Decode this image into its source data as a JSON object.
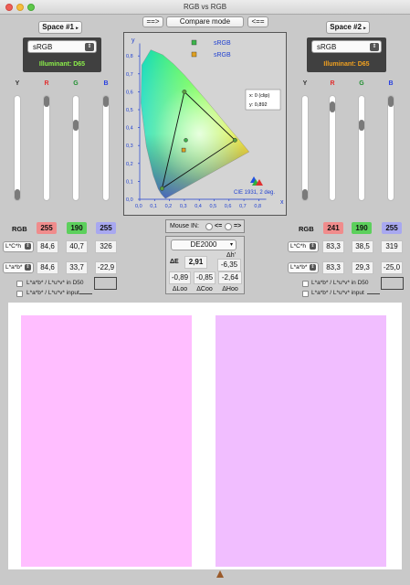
{
  "window": {
    "title": "RGB vs RGB"
  },
  "compare": {
    "left_arrow": "==>",
    "label": "Compare mode",
    "right_arrow": "<=="
  },
  "left": {
    "space_button": "Space #1",
    "profile": "sRGB",
    "illuminant": "Illuminant: D65",
    "illuminant_color": "#8cf04a",
    "channels": [
      "Y",
      "R",
      "G",
      "B"
    ],
    "sliders": [
      0.0,
      1.0,
      0.745,
      1.0
    ],
    "rgb_label": "RGB",
    "rgb": [
      "255",
      "190",
      "255"
    ],
    "lch_mode": "L*C*h",
    "lch": [
      "84,6",
      "40,7",
      "326"
    ],
    "lab_mode": "L*a*b*",
    "lab": [
      "84,6",
      "33,7",
      "-22,9"
    ],
    "chk_d50": "L*a*b* / L*u*v* in D50",
    "chk_input": "L*a*b* / L*u*v* input",
    "swatch": "#ffbeff"
  },
  "right": {
    "space_button": "Space #2",
    "profile": "sRGB",
    "illuminant": "Illuminant: D65",
    "illuminant_color": "#f0a020",
    "channels": [
      "Y",
      "R",
      "G",
      "B"
    ],
    "sliders": [
      0.0,
      0.945,
      0.745,
      1.0
    ],
    "rgb_label": "RGB",
    "rgb": [
      "241",
      "190",
      "255"
    ],
    "lch_mode": "L*C*h",
    "lch": [
      "83,3",
      "38,5",
      "319"
    ],
    "lab_mode": "L*a*b*",
    "lab": [
      "83,3",
      "29,3",
      "-25,0"
    ],
    "chk_d50": "L*a*b* / L*u*v* in D50",
    "chk_input": "L*a*b* / L*u*v* input",
    "swatch": "#f1beff"
  },
  "diagram": {
    "y_label": "y",
    "x_label": "x",
    "x_ticks": [
      "0,0",
      "0,1",
      "0,2",
      "0,3",
      "0,4",
      "0,5",
      "0,6",
      "0,7",
      "0,8"
    ],
    "y_ticks": [
      "0,0",
      "0,1",
      "0,2",
      "0,3",
      "0,4",
      "0,5",
      "0,6",
      "0,7",
      "0,8"
    ],
    "legend1": "sRGB",
    "legend2": "sRGB",
    "legend1_color": "#3cb44b",
    "legend2_color": "#e0a020",
    "readout_x": "x: 0 (clip)",
    "readout_y": "y: 0,892",
    "caption": "CIE 1931, 2 deg."
  },
  "mouse": {
    "label": "Mouse IN:",
    "opt1": "<=",
    "opt2": "=>"
  },
  "delta": {
    "method": "DE2000",
    "de_label": "ΔE",
    "de_value": "2,91",
    "dh_label": "Δh'",
    "dh_value": "-6,35",
    "values": [
      "-0,89",
      "-0,85",
      "-2,64"
    ],
    "labels": [
      "ΔLoo",
      "ΔCoo",
      "ΔHoo"
    ]
  }
}
